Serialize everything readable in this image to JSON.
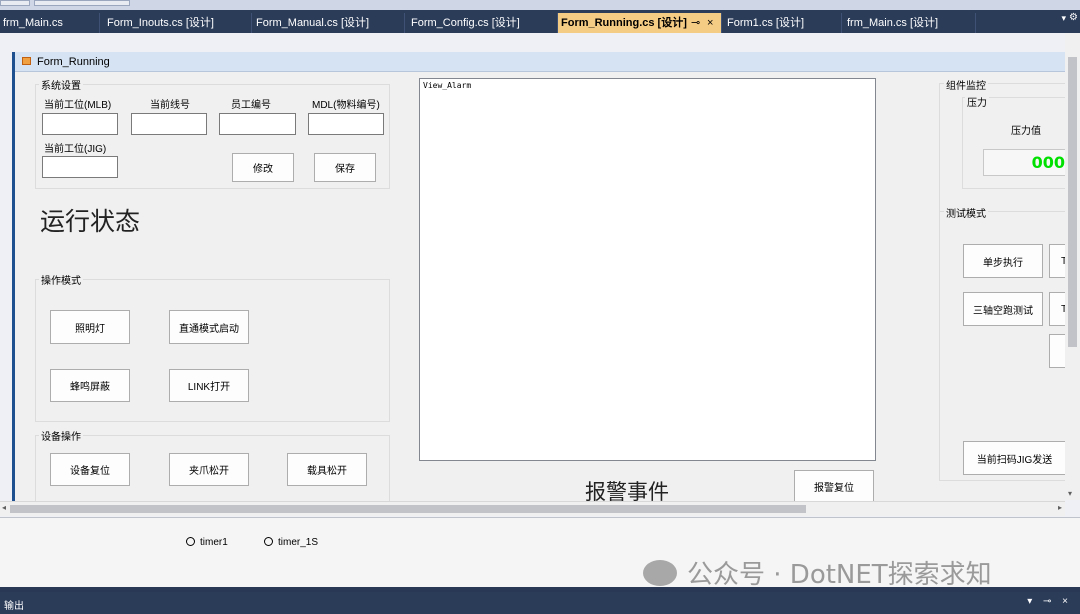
{
  "tabs": [
    {
      "label": "frm_Main.cs",
      "active": false
    },
    {
      "label": "Form_Inouts.cs [设计]",
      "active": false
    },
    {
      "label": "Form_Manual.cs [设计]",
      "active": false
    },
    {
      "label": "Form_Config.cs [设计]",
      "active": false
    },
    {
      "label": "Form_Running.cs [设计]",
      "active": true
    },
    {
      "label": "Form1.cs [设计]",
      "active": false
    },
    {
      "label": "frm_Main.cs [设计]",
      "active": false
    }
  ],
  "tab_controls": {
    "pin": "⊸",
    "close": "×",
    "overflow": "▾",
    "gear": "⚙"
  },
  "form": {
    "title": "Form_Running"
  },
  "system_settings": {
    "title": "系统设置",
    "labels": {
      "current_station_mlb": "当前工位(MLB)",
      "current_line": "当前线号",
      "employee_id": "员工编号",
      "mdl": "MDL(物料编号)",
      "current_station_jig": "当前工位(JIG)"
    },
    "values": {
      "current_station_mlb": "",
      "current_line": "",
      "employee_id": "",
      "mdl": "",
      "current_station_jig": ""
    },
    "buttons": {
      "modify": "修改",
      "save": "保存"
    }
  },
  "run_state": "运行状态",
  "operation_mode": {
    "title": "操作模式",
    "buttons": {
      "lighting": "照明灯",
      "direct_mode": "直通模式启动",
      "buzzer_mute": "蜂鸣屏蔽",
      "link_open": "LINK打开"
    }
  },
  "device_ops": {
    "title": "设备操作",
    "buttons": {
      "device_reset": "设备复位",
      "gripper_release": "夹爪松开",
      "carrier_release": "载具松开"
    }
  },
  "alarm": {
    "list_text": "View_Alarm",
    "title": "报警事件",
    "reset_button": "报警复位"
  },
  "monitor": {
    "title": "组件监控",
    "pressure_group": "压力",
    "pressure_label": "压力值",
    "pressure_value": "000"
  },
  "test_mode": {
    "title": "测试模式",
    "buttons": {
      "single_step": "单步执行",
      "three_axis": "三轴空跑测试",
      "jig_send": "当前扫码JIG发送",
      "t1": "T",
      "t2": "T"
    }
  },
  "tray": {
    "timers": [
      "timer1",
      "timer_1S"
    ]
  },
  "watermark": "公众号 · DotNET探索求知",
  "output": {
    "title": "输出",
    "controls": "▾ ⊸ ×"
  },
  "scroll": {
    "up": "▴",
    "down": "▾",
    "left": "◂",
    "right": "▸"
  }
}
